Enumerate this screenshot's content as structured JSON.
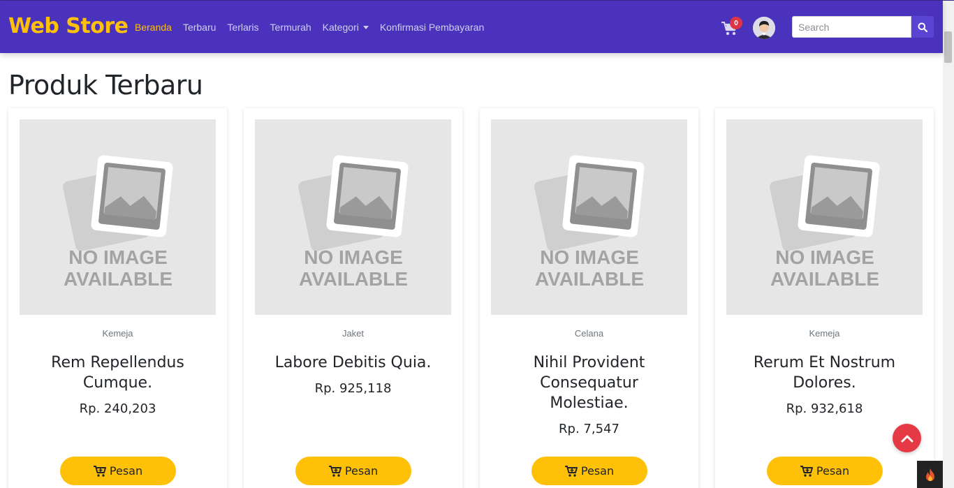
{
  "brand": "Web Store",
  "nav": {
    "links": [
      "Beranda",
      "Terbaru",
      "Terlaris",
      "Termurah",
      "Kategori",
      "Konfirmasi Pembayaran"
    ],
    "active": "Beranda"
  },
  "cart": {
    "count": "0"
  },
  "search": {
    "placeholder": "Search"
  },
  "page_title": "Produk Terbaru",
  "placeholder_image": {
    "line1": "NO IMAGE",
    "line2": "AVAILABLE"
  },
  "products": [
    {
      "category": "Kemeja",
      "name": "Rem Repellendus Cumque.",
      "price": "Rp. 240,203",
      "button": "Pesan"
    },
    {
      "category": "Jaket",
      "name": "Labore Debitis Quia.",
      "price": "Rp. 925,118",
      "button": "Pesan"
    },
    {
      "category": "Celana",
      "name": "Nihil Provident Consequatur Molestiae.",
      "price": "Rp. 7,547",
      "button": "Pesan"
    },
    {
      "category": "Kemeja",
      "name": "Rerum Et Nostrum Dolores.",
      "price": "Rp. 932,618",
      "button": "Pesan"
    }
  ],
  "colors": {
    "navbar": "#4a32bd",
    "accent": "#ffc107",
    "badge": "#dc3545",
    "scroll_top": "#e53945"
  },
  "icons": {
    "cart": "cart-icon",
    "search": "search-icon",
    "scroll_top": "chevron-up-icon",
    "fire": "fire-icon"
  }
}
